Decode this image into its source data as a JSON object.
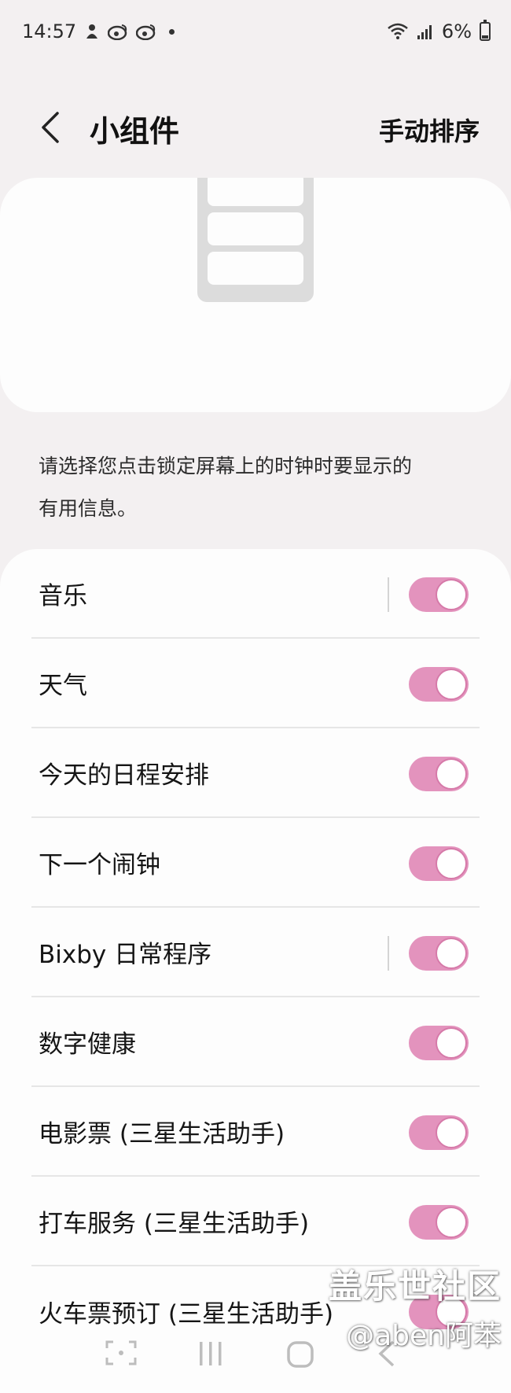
{
  "status_bar": {
    "time": "14:57",
    "battery": "6%"
  },
  "header": {
    "title": "小组件",
    "sort_action": "手动排序"
  },
  "description": {
    "line1": "请选择您点击锁定屏幕上的时钟时要显示的",
    "line2": "有用信息。"
  },
  "widgets": [
    {
      "label": "音乐",
      "enabled": true,
      "has_divider": true
    },
    {
      "label": "天气",
      "enabled": true,
      "has_divider": false
    },
    {
      "label": "今天的日程安排",
      "enabled": true,
      "has_divider": false
    },
    {
      "label": "下一个闹钟",
      "enabled": true,
      "has_divider": false
    },
    {
      "label": "Bixby 日常程序",
      "enabled": true,
      "has_divider": true
    },
    {
      "label": "数字健康",
      "enabled": true,
      "has_divider": false
    },
    {
      "label": "电影票 (三星生活助手)",
      "enabled": true,
      "has_divider": false
    },
    {
      "label": "打车服务 (三星生活助手)",
      "enabled": true,
      "has_divider": false
    },
    {
      "label": "火车票预订 (三星生活助手)",
      "enabled": true,
      "has_divider": false
    }
  ],
  "watermark": {
    "line1": "盖乐世社区",
    "line2": "@aben阿苯"
  },
  "colors": {
    "toggle_on": "#e393bd",
    "background": "#f3f0f1",
    "card": "#fdfdfd"
  }
}
